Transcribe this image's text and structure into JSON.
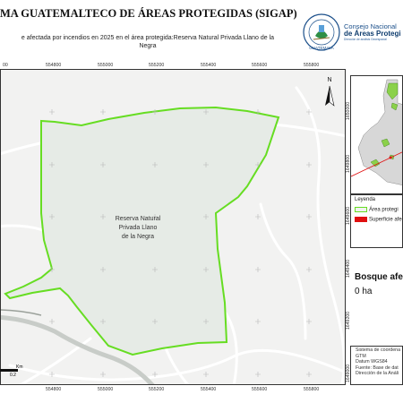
{
  "header": {
    "title": "MA GUATEMALTECO DE ÁREAS PROTEGIDAS  (SIGAP)",
    "subtitle_line1": "e afectada por incendios en 2025 en el área protegida:Reserva Natural Privada Llano de la",
    "subtitle_line2": "Negra",
    "seal_text": "GUATEMALA"
  },
  "brand": {
    "line1": "Consejo Nacional",
    "line2": "de Áreas Protegi",
    "line3": "Dirección de análisis Geoespacial"
  },
  "map": {
    "area_label_line1": "Reserva Natural",
    "area_label_line2": "Privada Llano",
    "area_label_line3": "de la Negra",
    "north_label": "N",
    "x_ticks": [
      "554800",
      "555000",
      "555200",
      "555400",
      "555600",
      "555800"
    ],
    "partial_x_left": "00",
    "y_ticks": [
      "1650000",
      "1649800",
      "1649600",
      "1649400",
      "1649200",
      "1649000"
    ],
    "scale_unit": "Km",
    "scale_value": "0.2",
    "colors": {
      "boundary": "#66dd22",
      "area_fill": "#e6ebe6",
      "background": "#f2f2f1",
      "roads": "#ffffff"
    }
  },
  "legend": {
    "title": "Leyenda",
    "items": [
      {
        "label": "Área protegi",
        "color": "#66dd22"
      },
      {
        "label": "Superficie afe",
        "color": "#e01010"
      }
    ]
  },
  "affected": {
    "heading": "Bosque afe",
    "value": "0 ha"
  },
  "info": {
    "lines": [
      "Sistema de coordena",
      "GTM",
      "Datum WGS84",
      "Fuente: Base de dat",
      "Dirección de la Análi"
    ]
  }
}
